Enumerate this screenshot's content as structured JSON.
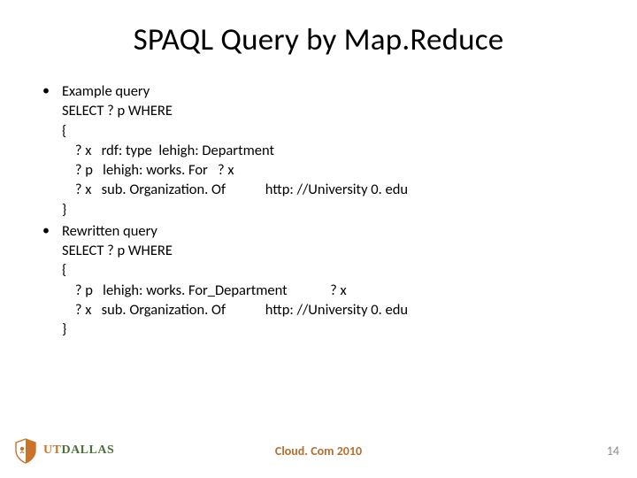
{
  "title": "SPAQL Query by Map.Reduce",
  "bullets": {
    "example_label": "Example query",
    "example_block": "SELECT ? p WHERE\n{\n    ? x   rdf: type  lehigh: Department\n    ? p   lehigh: works. For   ? x\n    ? x   sub. Organization. Of            http: //University 0. edu\n}",
    "rewritten_label": "Rewritten query",
    "rewritten_block": "SELECT ? p WHERE\n{\n    ? p   lehigh: works. For_Department             ? x\n    ? x   sub. Organization. Of            http: //University 0. edu\n}"
  },
  "footer": {
    "logo_ut": "UT",
    "logo_dallas": "DALLAS",
    "conference": "Cloud. Com 2010",
    "page": "14"
  }
}
